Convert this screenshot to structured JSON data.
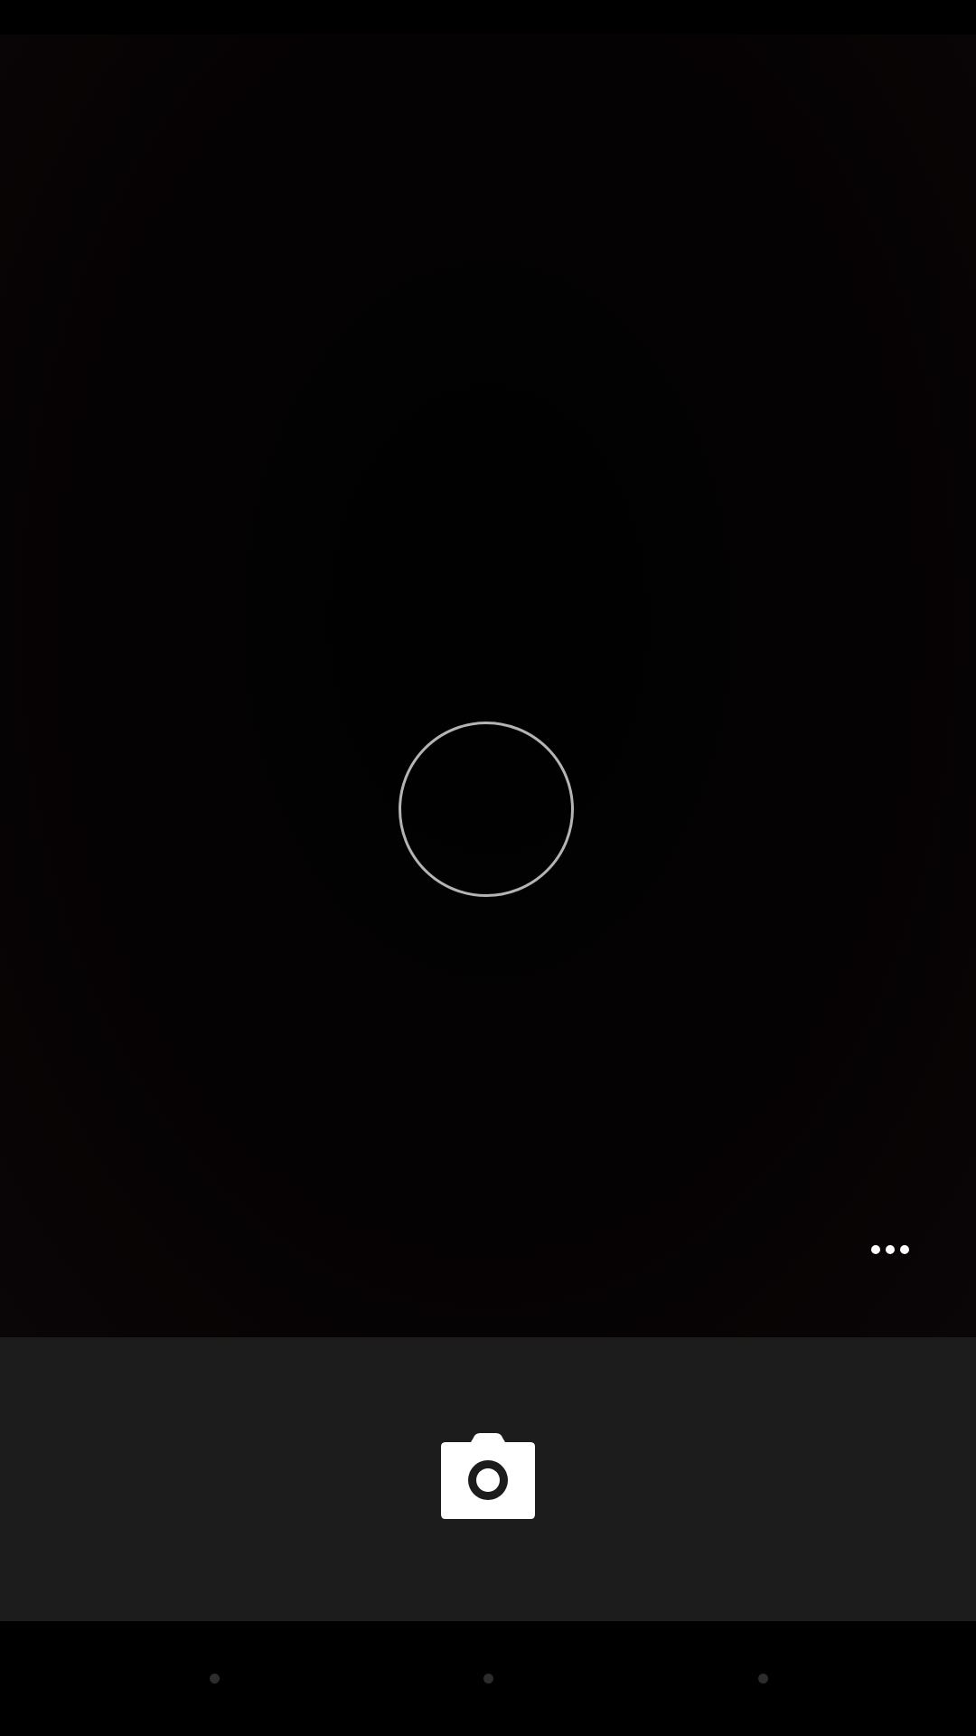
{
  "app": {
    "screen": "camera-viewfinder"
  },
  "viewfinder": {
    "focus_indicator": "focus-ring"
  },
  "controls": {
    "more_icon": "more-horiz-icon",
    "shutter_icon": "camera-icon"
  },
  "navigation": {
    "buttons": [
      "back-dot-icon",
      "home-dot-icon",
      "recents-dot-icon"
    ]
  },
  "colors": {
    "viewfinder_bg": "#050203",
    "control_bar_bg": "#1c1c1c",
    "focus_ring": "#b4b4b4",
    "icon": "#ffffff"
  }
}
